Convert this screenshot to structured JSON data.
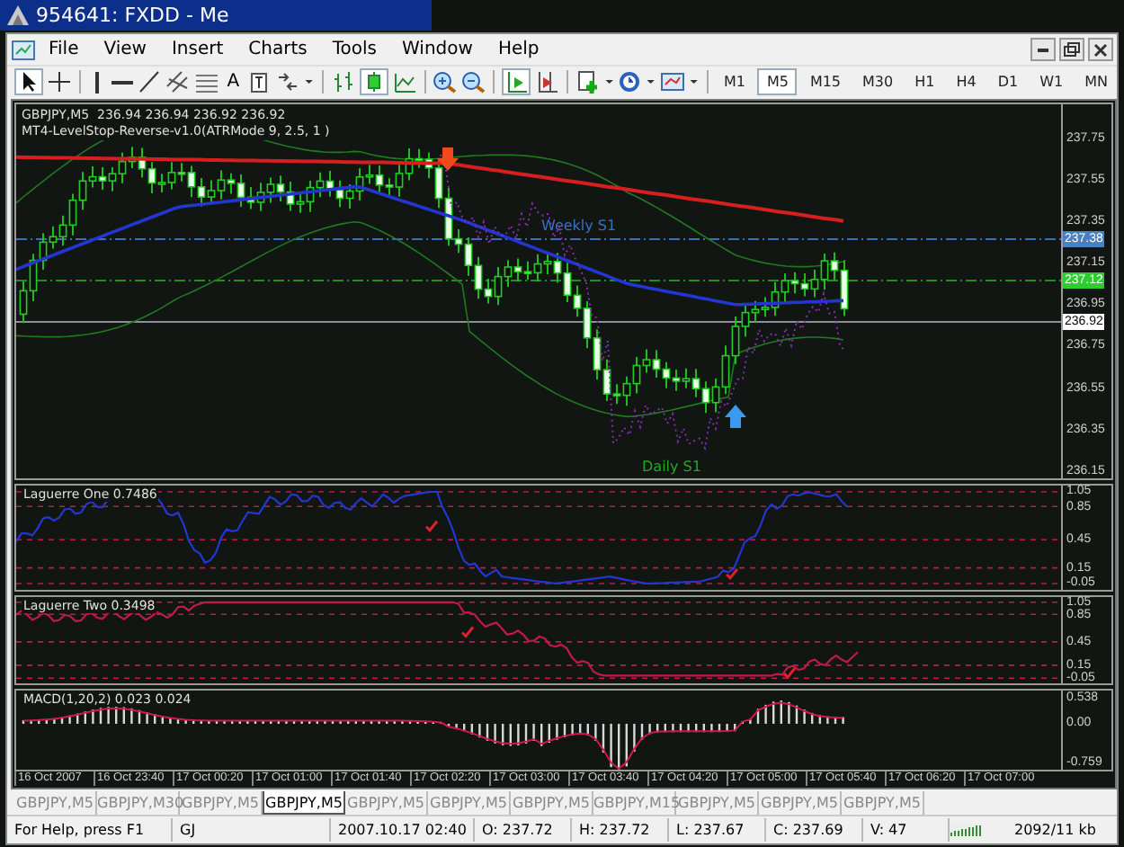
{
  "window": {
    "title": "954641: FXDD - Me"
  },
  "menu": [
    "File",
    "View",
    "Insert",
    "Charts",
    "Tools",
    "Window",
    "Help"
  ],
  "toolbar": {
    "text_tool": "A"
  },
  "timeframes": [
    {
      "label": "M1",
      "selected": false
    },
    {
      "label": "M5",
      "selected": true
    },
    {
      "label": "M15",
      "selected": false
    },
    {
      "label": "M30",
      "selected": false
    },
    {
      "label": "H1",
      "selected": false
    },
    {
      "label": "H4",
      "selected": false
    },
    {
      "label": "D1",
      "selected": false
    },
    {
      "label": "W1",
      "selected": false
    },
    {
      "label": "MN",
      "selected": false
    }
  ],
  "chart": {
    "legend": [
      "GBPJPY,M5  236.94 236.94 236.92 236.92",
      "MT4-LevelStop-Reverse-v1.0(ATRMode 9, 2.5, 1 )"
    ],
    "levels": [
      {
        "label": "Weekly S1"
      },
      {
        "label": "Daily S1"
      }
    ],
    "price_axis": [
      "237.75",
      "237.55",
      "237.35",
      "237.15",
      "236.95",
      "236.75",
      "236.55",
      "236.35",
      "236.15"
    ],
    "price_badges": [
      {
        "text": "237.38",
        "color": "#4a7fc0"
      },
      {
        "text": "237.12",
        "color": "#2ecc2e"
      },
      {
        "text": "236.92",
        "color": "#ffffff"
      }
    ]
  },
  "indicators": [
    {
      "kind": "laguerre",
      "title": "Laguerre One 0.7486",
      "axis": [
        "1.05",
        "0.85",
        "0.45",
        "0.15",
        "-0.05"
      ]
    },
    {
      "kind": "laguerre",
      "title": "Laguerre Two 0.3498",
      "axis": [
        "1.05",
        "0.85",
        "0.45",
        "0.15",
        "-0.05"
      ]
    },
    {
      "kind": "macd",
      "title": "MACD(1,20,2) 0.023 0.024",
      "axis": [
        "0.538",
        "0.00",
        "-0.759"
      ]
    }
  ],
  "time_axis": [
    "16 Oct 2007",
    "16 Oct 23:40",
    "17 Oct 00:20",
    "17 Oct 01:00",
    "17 Oct 01:40",
    "17 Oct 02:20",
    "17 Oct 03:00",
    "17 Oct 03:40",
    "17 Oct 04:20",
    "17 Oct 05:00",
    "17 Oct 05:40",
    "17 Oct 06:20",
    "17 Oct 07:00"
  ],
  "tabs": [
    {
      "label": "GBPJPY,M5",
      "selected": false
    },
    {
      "label": "GBPJPY,M30",
      "selected": false
    },
    {
      "label": "GBPJPY,M5",
      "selected": false
    },
    {
      "label": "GBPJPY,M5",
      "selected": true
    },
    {
      "label": "GBPJPY,M5",
      "selected": false
    },
    {
      "label": "GBPJPY,M5",
      "selected": false
    },
    {
      "label": "GBPJPY,M5",
      "selected": false
    },
    {
      "label": "GBPJPY,M15",
      "selected": false
    },
    {
      "label": "GBPJPY,M5",
      "selected": false
    },
    {
      "label": "GBPJPY,M5",
      "selected": false
    },
    {
      "label": "GBPJPY,M5",
      "selected": false
    }
  ],
  "status_bar": {
    "fields": [
      "For Help, press F1",
      "GJ",
      "2007.10.17 02:40",
      "O: 237.72",
      "H: 237.72",
      "L: 237.67",
      "C: 237.69",
      "V: 47"
    ],
    "traffic": "2092/11 kb"
  }
}
